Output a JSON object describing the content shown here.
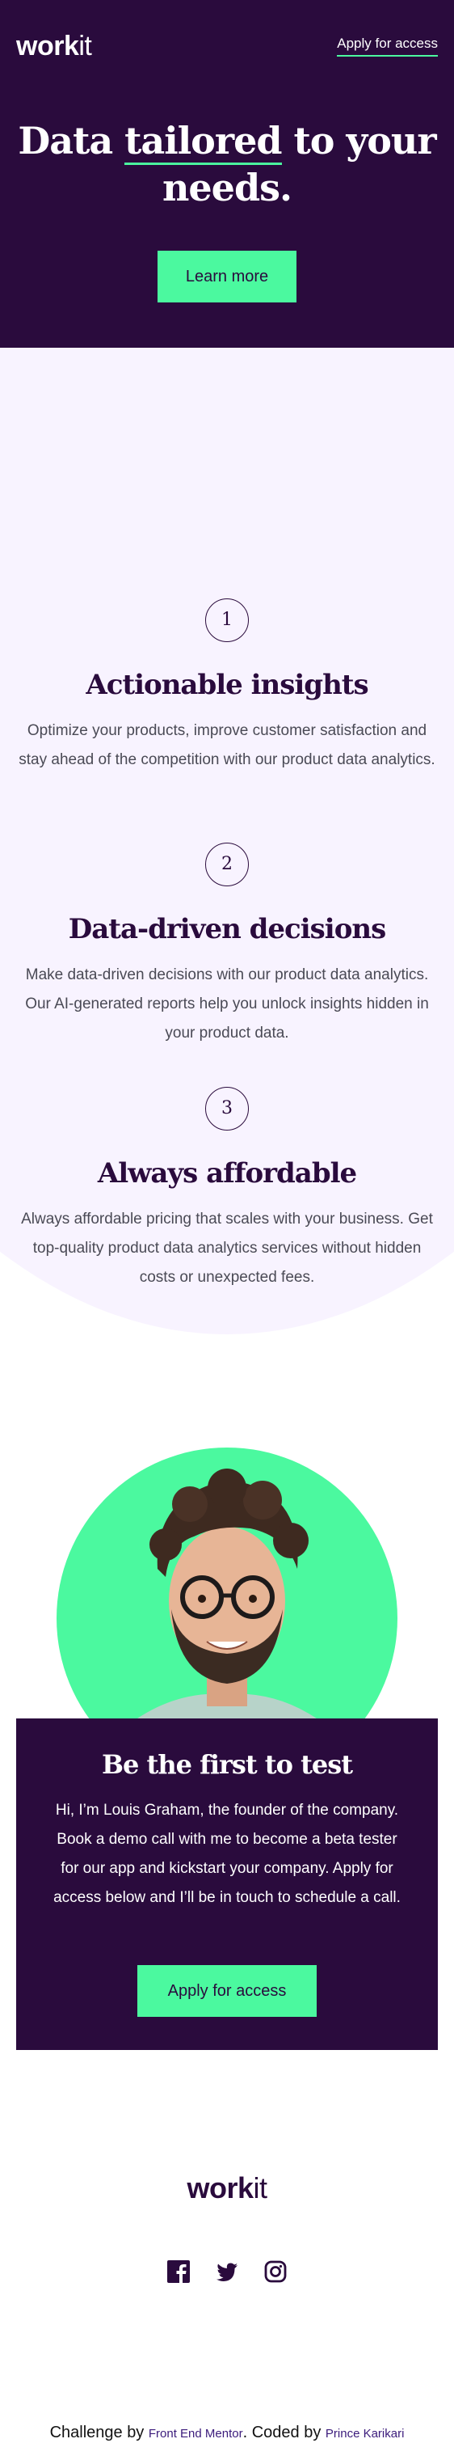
{
  "nav": {
    "logo_bold": "work",
    "logo_light": "it",
    "apply_link": "Apply for access"
  },
  "hero": {
    "title_pre": "Data ",
    "title_underlined": "tailored",
    "title_post": " to your needs.",
    "cta": "Learn more"
  },
  "features": [
    {
      "number": "1",
      "title": "Actionable insights",
      "text": "Optimize your products, improve customer satisfaction and stay ahead of the competition with our product data analytics."
    },
    {
      "number": "2",
      "title": "Data-driven decisions",
      "text": "Make data-driven decisions with our product data analytics. Our AI-generated reports help you unlock insights hidden in your product data."
    },
    {
      "number": "3",
      "title": "Always affordable",
      "text": "Always affordable pricing that scales with your business. Get top-quality product data analytics services without hidden costs or unexpected fees."
    }
  ],
  "founder": {
    "title": "Be the first to test",
    "text": "Hi, I’m Louis Graham, the founder of the company. Book a demo call with me to become a beta tester for our app and kickstart your company. Apply for access below and I’ll be in touch to schedule a call.",
    "cta": "Apply for access"
  },
  "footer": {
    "logo_bold": "work",
    "logo_light": "it",
    "socials": [
      "facebook-icon",
      "twitter-icon",
      "instagram-icon"
    ],
    "challenge_by": "Challenge by",
    "fem": "Front End Mentor",
    "coded_by": ". Coded by",
    "author": "Prince Karikari"
  },
  "colors": {
    "dark": "#2a0b3d",
    "accent": "#4bf99f",
    "light_bg": "#f8f3ff"
  }
}
